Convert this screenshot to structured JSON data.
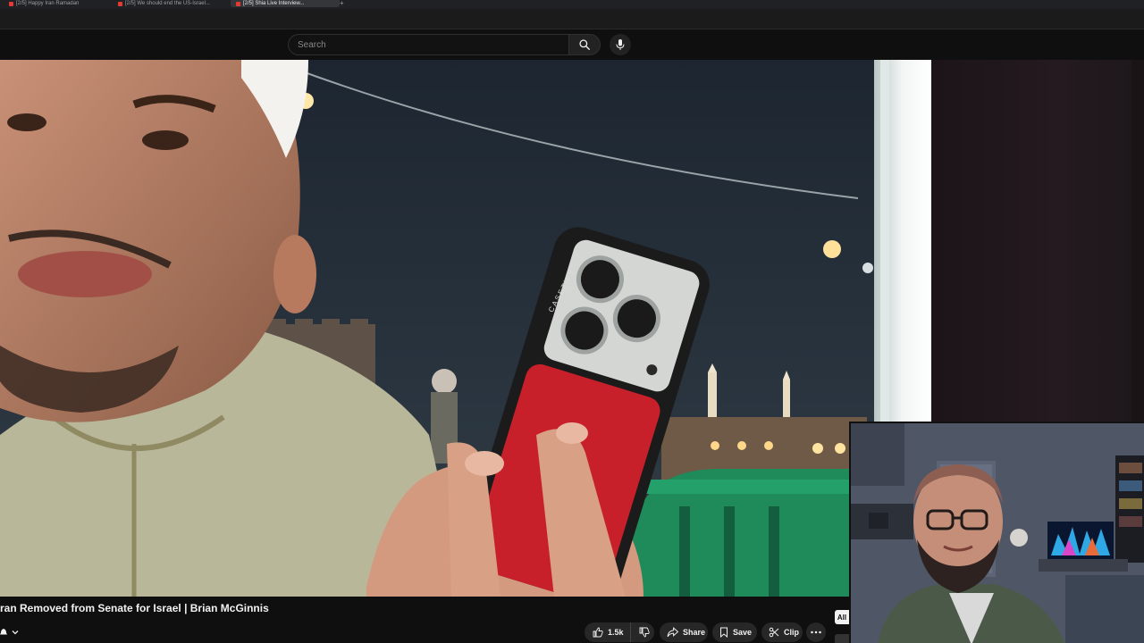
{
  "browser": {
    "tabs": [
      {
        "label": "[2/5] Happy Iran Ramadan",
        "active": false
      },
      {
        "label": "[2/5] We should end the US-Israel...",
        "active": false
      },
      {
        "label": "[2/5] Shia Live Interview...",
        "active": true
      }
    ]
  },
  "header": {
    "search": {
      "placeholder": "Search",
      "value": ""
    },
    "search_icon": "search-icon",
    "mic_icon": "mic-icon"
  },
  "video": {
    "title": "ran Removed from Senate for Israel | Brian McGinnis",
    "case_text": "CASETiFY"
  },
  "actions": {
    "like_count": "1.5k",
    "share_label": "Share",
    "save_label": "Save",
    "clip_label": "Clip",
    "more_icon": "more-icon"
  },
  "chip": {
    "label": "All"
  },
  "colors": {
    "background": "#0f0f0f",
    "pill": "#272727",
    "text": "#f1f1f1",
    "fence": "#1f8a5a",
    "phone_case": "#c8202a"
  }
}
